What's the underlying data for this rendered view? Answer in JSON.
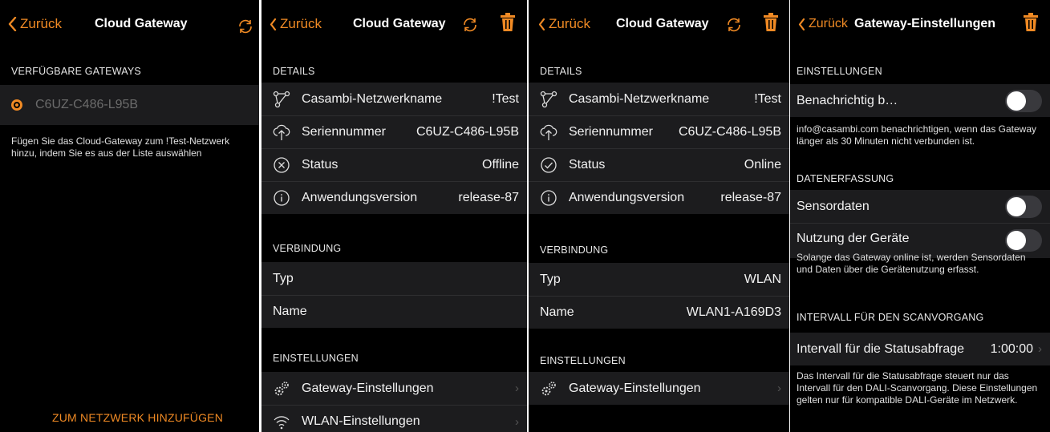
{
  "colors": {
    "accent": "#f08a24",
    "background": "#000000",
    "cell": "#1c1c1e",
    "toggle_off": "#39393d"
  },
  "p1": {
    "back": "Zurück",
    "title": "Cloud Gateway",
    "section": "VERFÜGBARE GATEWAYS",
    "gateway": "C6UZ-C486-L95B",
    "hint": "Fügen Sie das Cloud-Gateway zum !Test-Netzwerk hinzu, indem Sie es aus der Liste auswählen",
    "add_button": "ZUM NETZWERK HINZUFÜGEN"
  },
  "p2": {
    "back": "Zurück",
    "title": "Cloud Gateway",
    "details_header": "DETAILS",
    "details": [
      {
        "label": "Casambi-Netzwerkname",
        "value": "!Test",
        "icon": "network-icon"
      },
      {
        "label": "Seriennummer",
        "value": "C6UZ-C486-L95B",
        "icon": "cloud-upload-icon"
      },
      {
        "label": "Status",
        "value": "Offline",
        "icon": "offline-x-icon"
      },
      {
        "label": "Anwendungsversion",
        "value": "release-87",
        "icon": "info-icon"
      }
    ],
    "connection_header": "VERBINDUNG",
    "connection": [
      {
        "label": "Typ",
        "value": ""
      },
      {
        "label": "Name",
        "value": ""
      }
    ],
    "settings_header": "EINSTELLUNGEN",
    "settings": [
      {
        "label": "Gateway-Einstellungen",
        "icon": "gears-icon"
      },
      {
        "label": "WLAN-Einstellungen",
        "icon": "wifi-icon"
      }
    ]
  },
  "p3": {
    "back": "Zurück",
    "title": "Cloud Gateway",
    "details_header": "DETAILS",
    "details": [
      {
        "label": "Casambi-Netzwerkname",
        "value": "!Test",
        "icon": "network-icon"
      },
      {
        "label": "Seriennummer",
        "value": "C6UZ-C486-L95B",
        "icon": "cloud-upload-icon"
      },
      {
        "label": "Status",
        "value": "Online",
        "icon": "online-check-icon"
      },
      {
        "label": "Anwendungsversion",
        "value": "release-87",
        "icon": "info-icon"
      }
    ],
    "connection_header": "VERBINDUNG",
    "connection": [
      {
        "label": "Typ",
        "value": "WLAN"
      },
      {
        "label": "Name",
        "value": "WLAN1-A169D3"
      }
    ],
    "settings_header": "EINSTELLUNGEN",
    "settings": [
      {
        "label": "Gateway-Einstellungen",
        "icon": "gears-icon"
      }
    ]
  },
  "p4": {
    "back": "Zurück",
    "title": "Gateway-Einstellungen",
    "settings_header": "EINSTELLUNGEN",
    "notify_label": "Benachrichtig bei Verbindungsabbruch",
    "notify_on": false,
    "notify_footer": "info@casambi.com benachrichtigen, wenn das Gateway länger als 30 Minuten nicht verbunden ist.",
    "data_header": "DATENERFASSUNG",
    "sensor_label": "Sensordaten",
    "sensor_on": false,
    "usage_label": "Nutzung der Geräte",
    "usage_on": false,
    "usage_desc": "Solange das Gateway online ist, werden Sensordaten und Daten über die Gerätenutzung erfasst.",
    "interval_header": "INTERVALL FÜR DEN SCANVORGANG",
    "interval_label": "Intervall für die Statusabfrage",
    "interval_value": "1:00:00",
    "interval_footer": "Das Intervall für die Statusabfrage steuert nur das Intervall für den DALI-Scanvorgang. Diese Einstellungen gelten nur für kompatible DALI-Geräte im Netzwerk."
  }
}
